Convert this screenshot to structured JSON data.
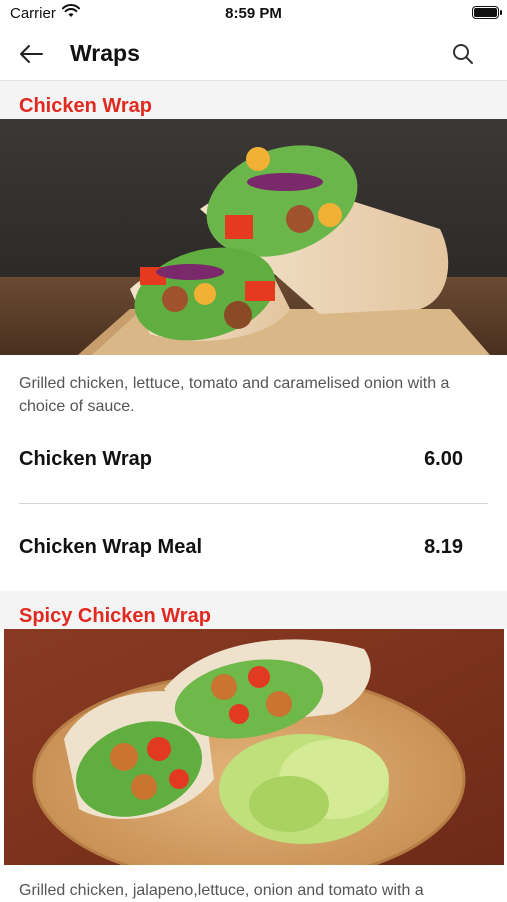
{
  "status_bar": {
    "carrier": "Carrier",
    "time": "8:59 PM"
  },
  "nav": {
    "title": "Wraps"
  },
  "categories": [
    {
      "title": "Chicken Wrap",
      "description": "Grilled chicken, lettuce, tomato and caramelised onion with a choice of sauce.",
      "options": [
        {
          "name": "Chicken Wrap",
          "price": "6.00"
        },
        {
          "name": "Chicken Wrap Meal",
          "price": "8.19"
        }
      ]
    },
    {
      "title": "Spicy Chicken Wrap",
      "description": "Grilled chicken, jalapeno,lettuce, onion and tomato with a"
    }
  ],
  "icons": [
    "back-arrow-icon",
    "search-icon",
    "wifi-icon",
    "battery-icon"
  ],
  "colors": {
    "accent": "#e02a21",
    "header_bg": "#f4f4f4"
  }
}
